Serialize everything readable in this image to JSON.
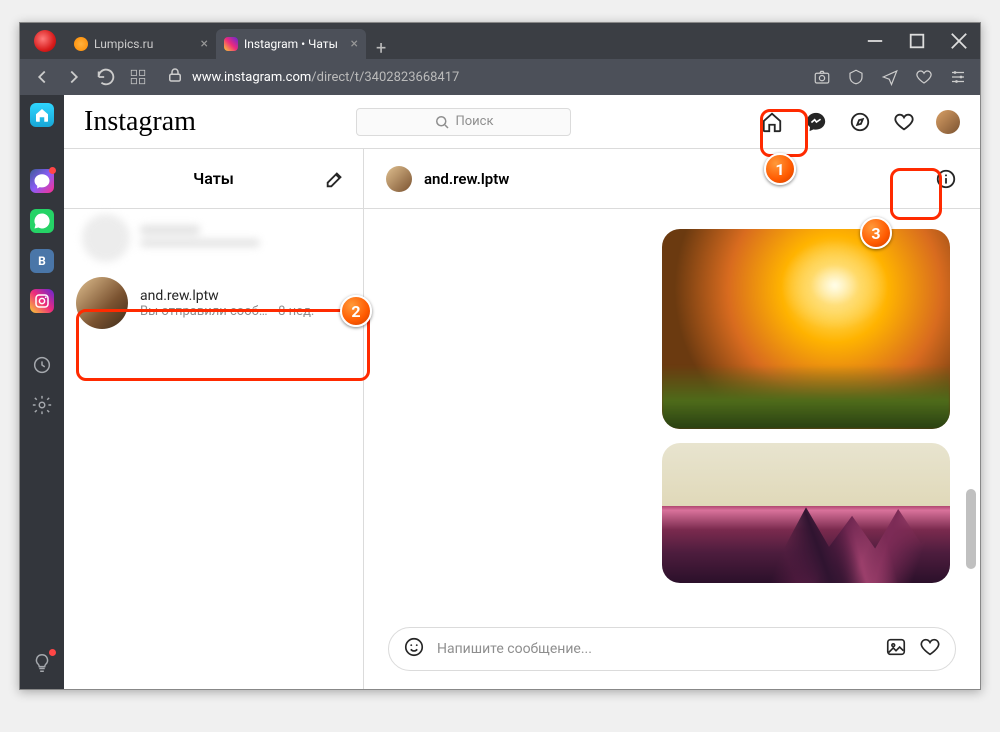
{
  "browser": {
    "tabs": [
      {
        "title": "Lumpics.ru",
        "active": false
      },
      {
        "title": "Instagram • Чаты",
        "active": true
      }
    ],
    "url_host": "www.instagram.com",
    "url_path": "/direct/t/3402823668417"
  },
  "instagram": {
    "logo_text": "Instagram",
    "search_placeholder": "Поиск",
    "left": {
      "title": "Чаты",
      "conversations": [
        {
          "name": "and.rew.lptw",
          "preview": "Вы отправили сооб…",
          "time": "· 8 нед."
        }
      ]
    },
    "chat": {
      "header_name": "and.rew.lptw",
      "input_placeholder": "Напишите сообщение..."
    }
  },
  "markers": {
    "m1": "1",
    "m2": "2",
    "m3": "3"
  }
}
